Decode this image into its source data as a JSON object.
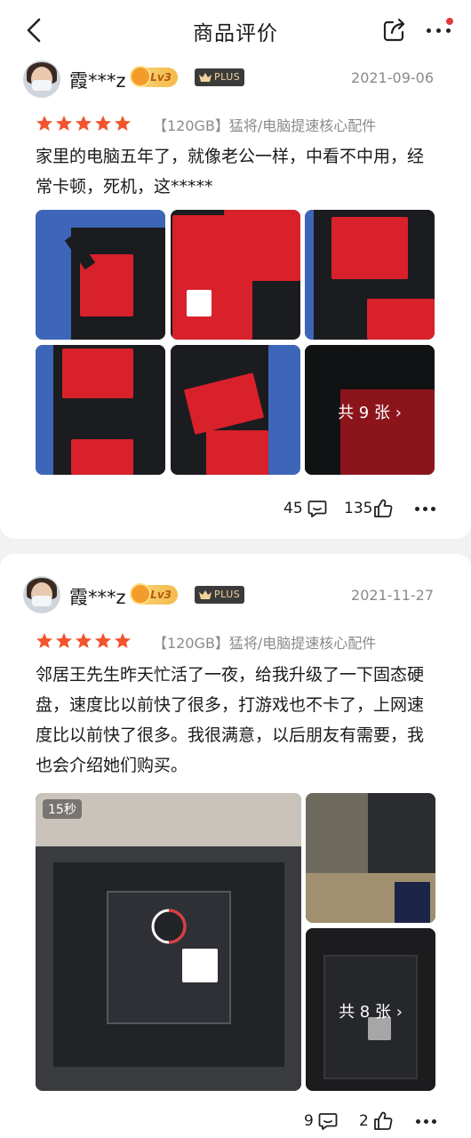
{
  "header": {
    "title": "商品评价",
    "icons": [
      "back-chevron-icon",
      "share-icon",
      "more-icon"
    ]
  },
  "reviews": [
    {
      "username": "霞***z",
      "level": "Lv3",
      "member": "PLUS",
      "date": "2021-09-06",
      "rating": 5,
      "spec": "【120GB】猛将/电脑提速核心配件",
      "content": "家里的电脑五年了，就像老公一样，中看不中用，经常卡顿，死机，这*****",
      "image_count_label": "共 9 张 ›",
      "comment_count": "45",
      "like_count": "135"
    },
    {
      "username": "霞***z",
      "level": "Lv3",
      "member": "PLUS",
      "date": "2021-11-27",
      "rating": 5,
      "spec": "【120GB】猛将/电脑提速核心配件",
      "content": "邻居王先生昨天忙活了一夜，给我升级了一下固态硬盘，速度比以前快了很多，打游戏也不卡了，上网速度比以前快了很多。我很满意，以后朋友有需要，我也会介绍她们购买。",
      "video_duration": "15秒",
      "image_count_label": "共 8 张 ›",
      "comment_count": "9",
      "like_count": "2"
    }
  ],
  "colors": {
    "star": "#f2542d",
    "accent_red": "#e4393c",
    "plus_gold": "#f1d49b",
    "page_bg": "#f2f2f2"
  }
}
